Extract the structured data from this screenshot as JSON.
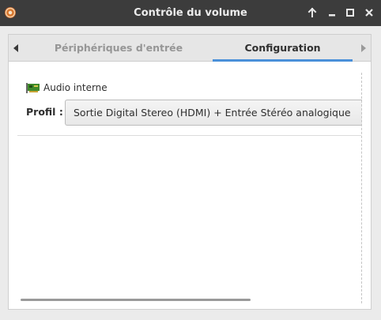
{
  "window": {
    "title": "Contrôle du volume"
  },
  "tabs": [
    {
      "label": "Périphériques d'entrée",
      "active": false
    },
    {
      "label": "Configuration",
      "active": true
    }
  ],
  "device": {
    "name": "Audio interne",
    "icon": "sound-card-icon"
  },
  "profile": {
    "label": "Profil :",
    "selected": "Sortie Digital Stereo (HDMI) + Entrée Stéréo analogique"
  },
  "colors": {
    "titlebar": "#3c3c3c",
    "active_tab_underline": "#4a90d9"
  }
}
